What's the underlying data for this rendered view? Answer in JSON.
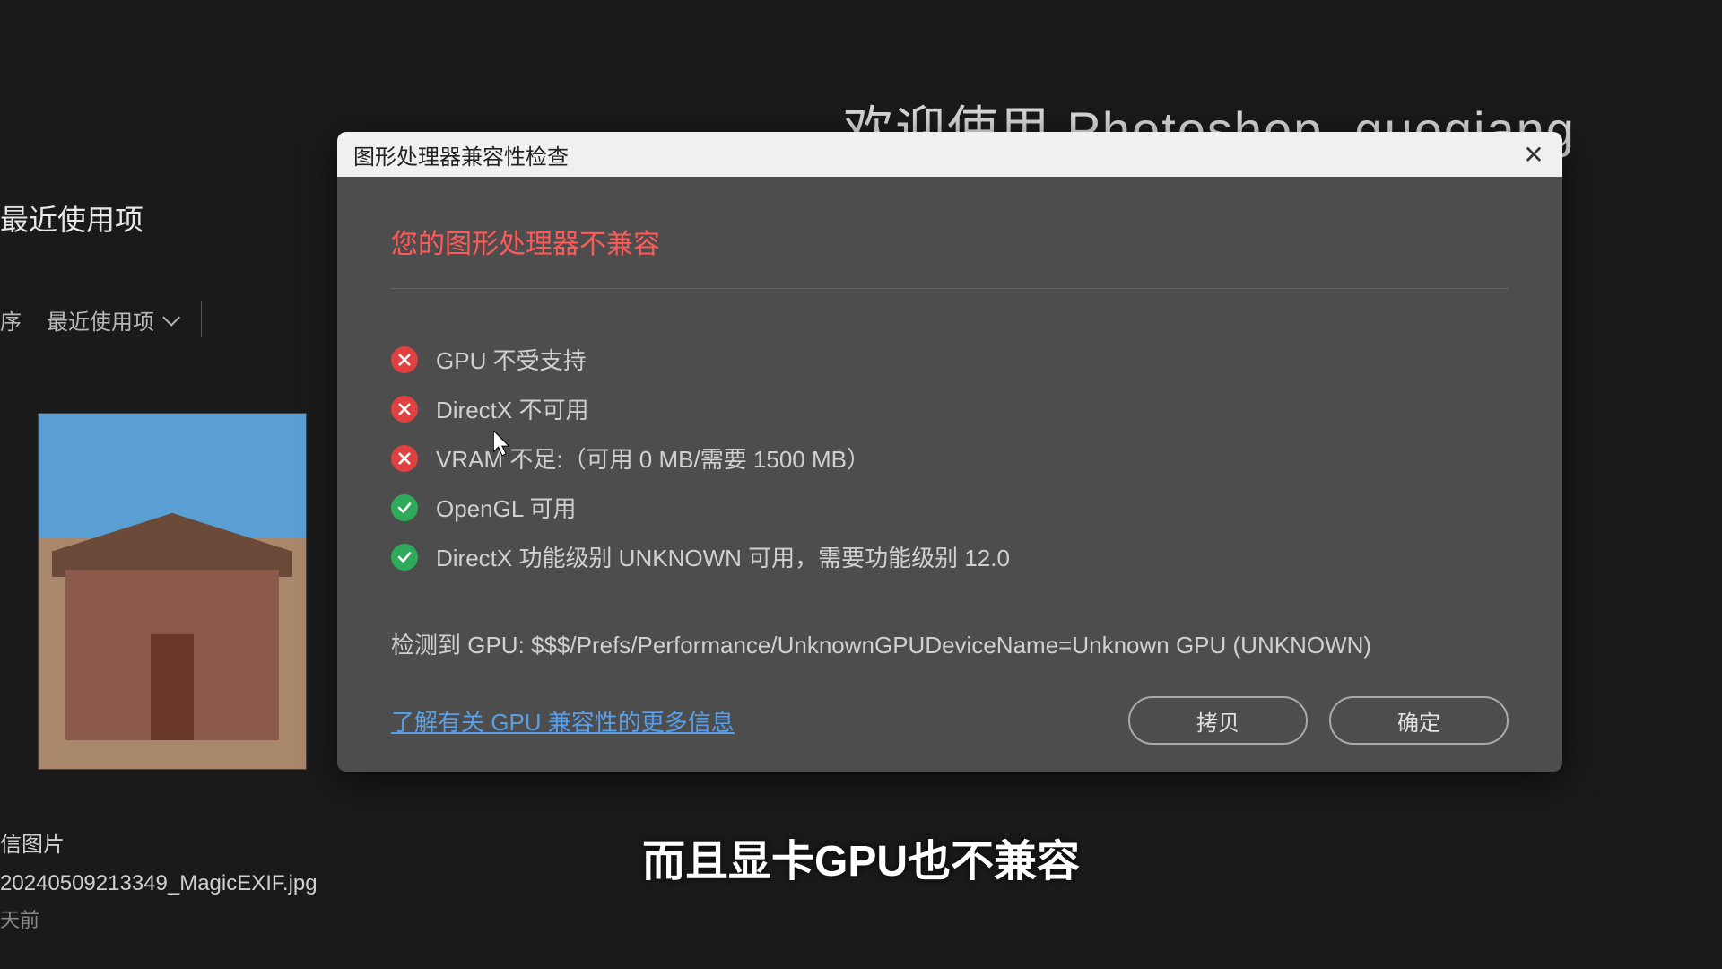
{
  "background": {
    "welcome": "欢迎使用 Photoshop,  guoqiang"
  },
  "sidebar": {
    "recent_header": "最近使用项",
    "sort_label": "序",
    "dropdown_label": "最近使用项"
  },
  "file": {
    "line1": "信图片",
    "line2": "20240509213349_MagicEXIF.jpg",
    "line3": "天前"
  },
  "dialog": {
    "title": "图形处理器兼容性检查",
    "heading": "您的图形处理器不兼容",
    "checks": [
      {
        "status": "fail",
        "text": "GPU 不受支持"
      },
      {
        "status": "fail",
        "text": "DirectX 不可用"
      },
      {
        "status": "fail",
        "text": "VRAM 不足:（可用 0 MB/需要 1500 MB）"
      },
      {
        "status": "ok",
        "text": "OpenGL 可用"
      },
      {
        "status": "ok",
        "text": "DirectX 功能级别 UNKNOWN 可用，需要功能级别 12.0"
      }
    ],
    "detected": "检测到 GPU: $$$/Prefs/Performance/UnknownGPUDeviceName=Unknown GPU (UNKNOWN)",
    "learn_more": "了解有关 GPU 兼容性的更多信息",
    "copy_btn": "拷贝",
    "ok_btn": "确定"
  },
  "subtitle": "而且显卡GPU也不兼容"
}
